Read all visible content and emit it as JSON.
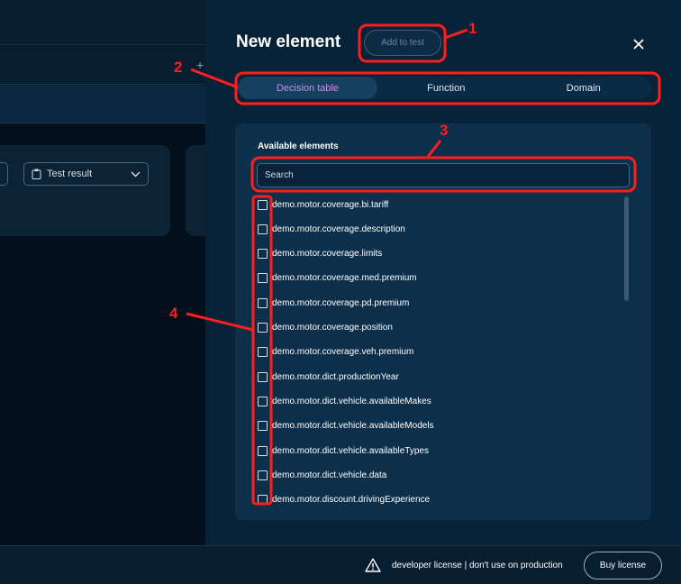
{
  "background_app": {
    "select_label": "Test result"
  },
  "panel": {
    "title": "New element",
    "add_button_label": "Add to test",
    "tabs": [
      {
        "label": "Decision table",
        "active": true
      },
      {
        "label": "Function",
        "active": false
      },
      {
        "label": "Domain",
        "active": false
      }
    ],
    "available_label": "Available elements",
    "search_placeholder": "Search",
    "items": [
      "demo.motor.coverage.bi.tariff",
      "demo.motor.coverage.description",
      "demo.motor.coverage.limits",
      "demo.motor.coverage.med.premium",
      "demo.motor.coverage.pd.premium",
      "demo.motor.coverage.position",
      "demo.motor.coverage.veh.premium",
      "demo.motor.dict.productionYear",
      "demo.motor.dict.vehicle.availableMakes",
      "demo.motor.dict.vehicle.availableModels",
      "demo.motor.dict.vehicle.availableTypes",
      "demo.motor.dict.vehicle.data",
      "demo.motor.discount.drivingExperience"
    ]
  },
  "footer": {
    "license_text": "developer license | don't use on production",
    "buy_button_label": "Buy license"
  },
  "annotations": {
    "labels": [
      "1",
      "2",
      "3",
      "4"
    ],
    "color": "#ff1d1d"
  },
  "colors": {
    "accent_tab_text": "#c58fe2",
    "panel_bg": "#082238",
    "box_bg": "#0c2f4b"
  }
}
